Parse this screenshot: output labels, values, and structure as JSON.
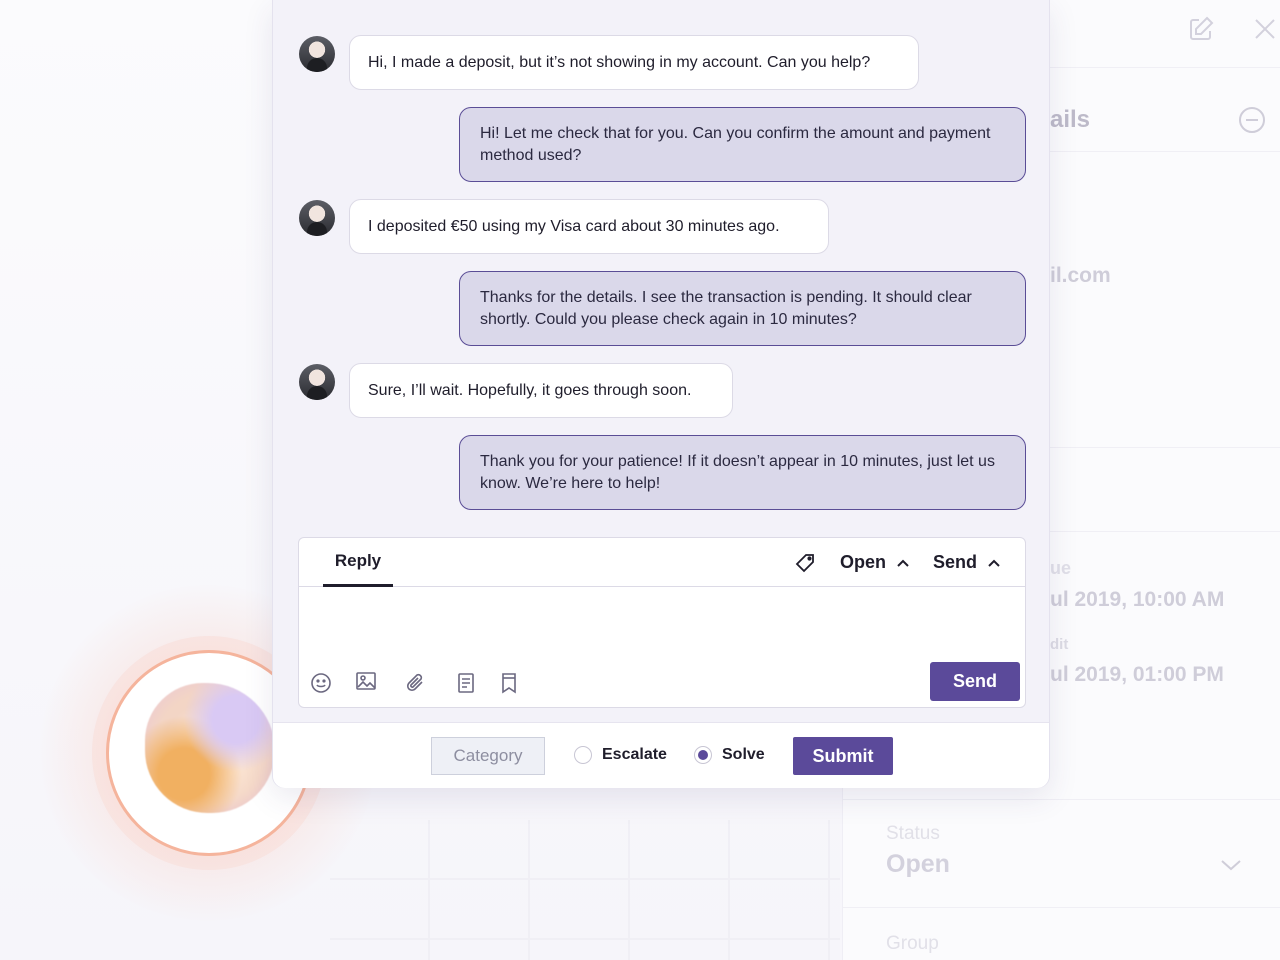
{
  "background_panel": {
    "title_fragment": "ails",
    "email_fragment": "il.com",
    "due_label_fragment": "ue",
    "due_value_fragment": "ul 2019, 10:00 AM",
    "edit_label_fragment": "dit",
    "edit_value_fragment": "ul 2019, 01:00 PM",
    "status_label": "Status",
    "status_value": "Open",
    "group_label": "Group"
  },
  "conversation": {
    "messages": [
      {
        "from": "customer",
        "text": "Hi, I made a deposit, but it’s not showing in my account. Can you help?"
      },
      {
        "from": "agent",
        "text": "Hi! Let me check that for you. Can you confirm the amount and payment method used?"
      },
      {
        "from": "customer",
        "text": "I deposited €50 using my Visa card about 30 minutes ago."
      },
      {
        "from": "agent",
        "text": "Thanks for the details. I see the transaction is pending. It should clear shortly. Could you please check again in 10 minutes?"
      },
      {
        "from": "customer",
        "text": "Sure, I’ll wait. Hopefully, it goes through soon."
      },
      {
        "from": "agent",
        "text": "Thank you for your patience! If it doesn’t appear in 10 minutes, just let us know. We’re here to help!"
      }
    ]
  },
  "reply": {
    "tab_label": "Reply",
    "status_label": "Open",
    "send_menu_label": "Send",
    "send_button": "Send"
  },
  "footer": {
    "category_label": "Category",
    "escalate_label": "Escalate",
    "solve_label": "Solve",
    "selected_option": "Solve",
    "submit_label": "Submit"
  },
  "colors": {
    "accent": "#5b4a9a",
    "agent_bubble": "#dad8ea",
    "customer_bubble": "#ffffff"
  }
}
